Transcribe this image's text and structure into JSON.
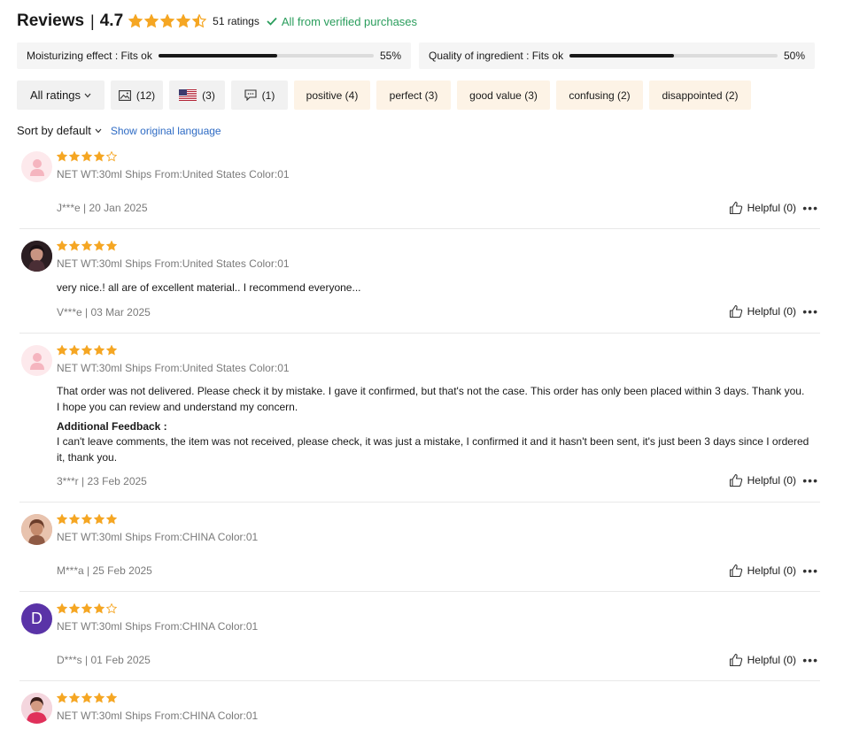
{
  "header": {
    "title": "Reviews",
    "separator": "|",
    "score": "4.7",
    "star_rating": 4.5,
    "ratings_count": "51 ratings",
    "verified_text": "All from verified purchases",
    "accent_color": "#f5a623",
    "verified_color": "#2a9d5c"
  },
  "metrics": [
    {
      "label": "Moisturizing effect : Fits ok",
      "percent": 55,
      "percent_text": "55%"
    },
    {
      "label": "Quality of ingredient : Fits ok",
      "percent": 50,
      "percent_text": "50%"
    }
  ],
  "filters": {
    "all_ratings": "All ratings",
    "photo_count": "(12)",
    "flag_count": "(3)",
    "comment_count": "(1)",
    "tags": [
      "positive (4)",
      "perfect (3)",
      "good value (3)",
      "confusing (2)",
      "disappointed (2)"
    ]
  },
  "sort": {
    "label": "Sort by default",
    "show_original": "Show original language"
  },
  "reviews": [
    {
      "rating": 4,
      "meta": "NET WT:30ml Ships From:United States Color:01",
      "text": "",
      "footer": "J***e | 20 Jan 2025",
      "helpful": "Helpful (0)"
    },
    {
      "rating": 5,
      "meta": "NET WT:30ml Ships From:United States Color:01",
      "text": "very nice.! all are of excellent material.. I recommend everyone...",
      "footer": "V***e | 03 Mar 2025",
      "helpful": "Helpful (0)"
    },
    {
      "rating": 5,
      "meta": "NET WT:30ml Ships From:United States Color:01",
      "text": "That order was not delivered. Please check it by mistake. I gave it confirmed, but that's not the case. This order has only been placed within 3 days. Thank you. I hope you can review and understand my concern.",
      "additional_label": "Additional Feedback :",
      "additional_text": "I can't leave comments, the item was not received, please check, it was just a mistake, I confirmed it and it hasn't been sent, it's just been 3 days since I ordered it, thank you.",
      "footer": "3***r | 23 Feb 2025",
      "helpful": "Helpful (0)"
    },
    {
      "rating": 5,
      "meta": "NET WT:30ml Ships From:CHINA Color:01",
      "text": "",
      "footer": "M***a | 25 Feb 2025",
      "helpful": "Helpful (0)"
    },
    {
      "rating": 4,
      "avatar_letter": "D",
      "meta": "NET WT:30ml Ships From:CHINA Color:01",
      "text": "",
      "footer": "D***s | 01 Feb 2025",
      "helpful": "Helpful (0)"
    },
    {
      "rating": 5,
      "meta": "NET WT:30ml Ships From:CHINA Color:01",
      "text": "",
      "footer": "",
      "helpful": ""
    }
  ]
}
